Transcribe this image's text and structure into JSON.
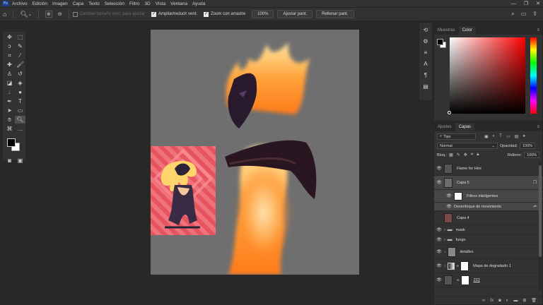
{
  "app": {
    "logo": "Ps"
  },
  "menu": [
    "Archivo",
    "Edición",
    "Imagen",
    "Capa",
    "Texto",
    "Selección",
    "Filtro",
    "3D",
    "Vista",
    "Ventana",
    "Ayuda"
  ],
  "window_controls": {
    "minimize": "—",
    "restore": "❐",
    "close": "✕"
  },
  "options_bar": {
    "resize_windows_label": "Cambiar tamaño vent. para ajustar",
    "zoom_all_windows_label": "Ampliar/reducir vent.",
    "scrubby_zoom_label": "Zoom con arrastre",
    "zoom_value": "100%",
    "fit_screen_label": "Ajustar pant.",
    "fill_screen_label": "Rellenar pant."
  },
  "color_panel": {
    "tabs": [
      "Muestras",
      "Color"
    ],
    "active_tab": "Color",
    "foreground": "#000000",
    "background": "#ffffff",
    "hue_color": "#ff0000"
  },
  "layers_panel": {
    "tabs": [
      "Ajustes",
      "Capas"
    ],
    "active_tab": "Capas",
    "filter_kind": "Tipo",
    "blend_mode": "Normal",
    "opacity_label": "Opacidad:",
    "opacity_value": "100%",
    "lock_label": "Bloq.:",
    "fill_label": "Relleno:",
    "fill_value": "100%",
    "layers": [
      {
        "name": "Flame for Hire",
        "visible": true,
        "selected": false
      },
      {
        "name": "Capa 5",
        "visible": true,
        "selected": true
      },
      {
        "name": "Filtros inteligentes",
        "visible": true,
        "selected": true
      },
      {
        "name": "Desenfoque de movimiento",
        "visible": true,
        "selected": true
      },
      {
        "name": "Capa 4",
        "visible": false,
        "selected": false
      },
      {
        "name": "mask",
        "visible": true,
        "selected": false
      },
      {
        "name": "fuego",
        "visible": true,
        "selected": false
      },
      {
        "name": "detalles",
        "visible": true,
        "selected": false
      },
      {
        "name": "Mapa de degradado 1",
        "visible": true,
        "selected": false
      },
      {
        "name": "222",
        "visible": true,
        "selected": false
      }
    ]
  }
}
